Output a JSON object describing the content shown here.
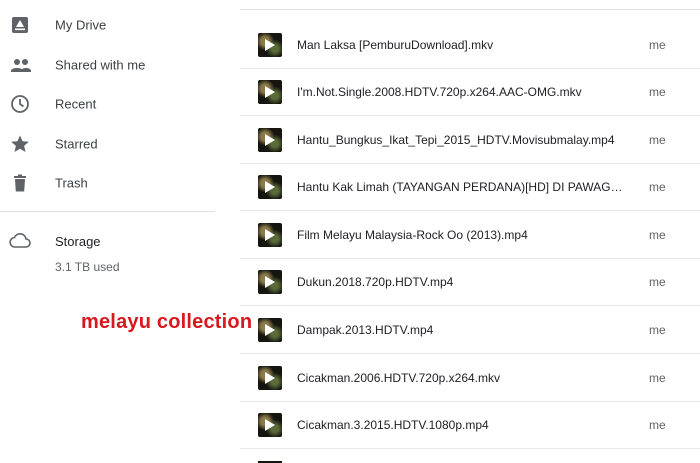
{
  "sidebar": {
    "items": [
      {
        "label": "My Drive",
        "icon": "my-drive-icon"
      },
      {
        "label": "Shared with me",
        "icon": "people-icon"
      },
      {
        "label": "Recent",
        "icon": "clock-icon"
      },
      {
        "label": "Starred",
        "icon": "star-icon"
      },
      {
        "label": "Trash",
        "icon": "trash-icon"
      }
    ],
    "storage": {
      "title": "Storage",
      "used": "3.1 TB used",
      "icon": "cloud-icon"
    }
  },
  "files": [
    {
      "name": "Man Laksa [PemburuDownload].mkv",
      "owner": "me",
      "icon": "video-thumbnail"
    },
    {
      "name": "I'm.Not.Single.2008.HDTV.720p.x264.AAC-OMG.mkv",
      "owner": "me",
      "icon": "video-thumbnail"
    },
    {
      "name": "Hantu_Bungkus_Ikat_Tepi_2015_HDTV.Movisubmalay.mp4",
      "owner": "me",
      "icon": "video-thumbnail"
    },
    {
      "name": "Hantu Kak Limah (TAYANGAN PERDANA)[HD] DI PAWAG…",
      "owner": "me",
      "icon": "video-thumbnail"
    },
    {
      "name": "Film Melayu Malaysia-Rock Oo (2013).mp4",
      "owner": "me",
      "icon": "video-thumbnail"
    },
    {
      "name": "Dukun.2018.720p.HDTV.mp4",
      "owner": "me",
      "icon": "video-thumbnail"
    },
    {
      "name": "Dampak.2013.HDTV.mp4",
      "owner": "me",
      "icon": "video-thumbnail"
    },
    {
      "name": "Cicakman.2006.HDTV.720p.x264.mkv",
      "owner": "me",
      "icon": "video-thumbnail"
    },
    {
      "name": "Cicakman.3.2015.HDTV.1080p.mp4",
      "owner": "me",
      "icon": "video-thumbnail"
    }
  ],
  "overlay_text": "melayu collection",
  "colors": {
    "overlay": "#d7191e",
    "icon": "#5f6368",
    "divider": "#e0e0e0"
  }
}
